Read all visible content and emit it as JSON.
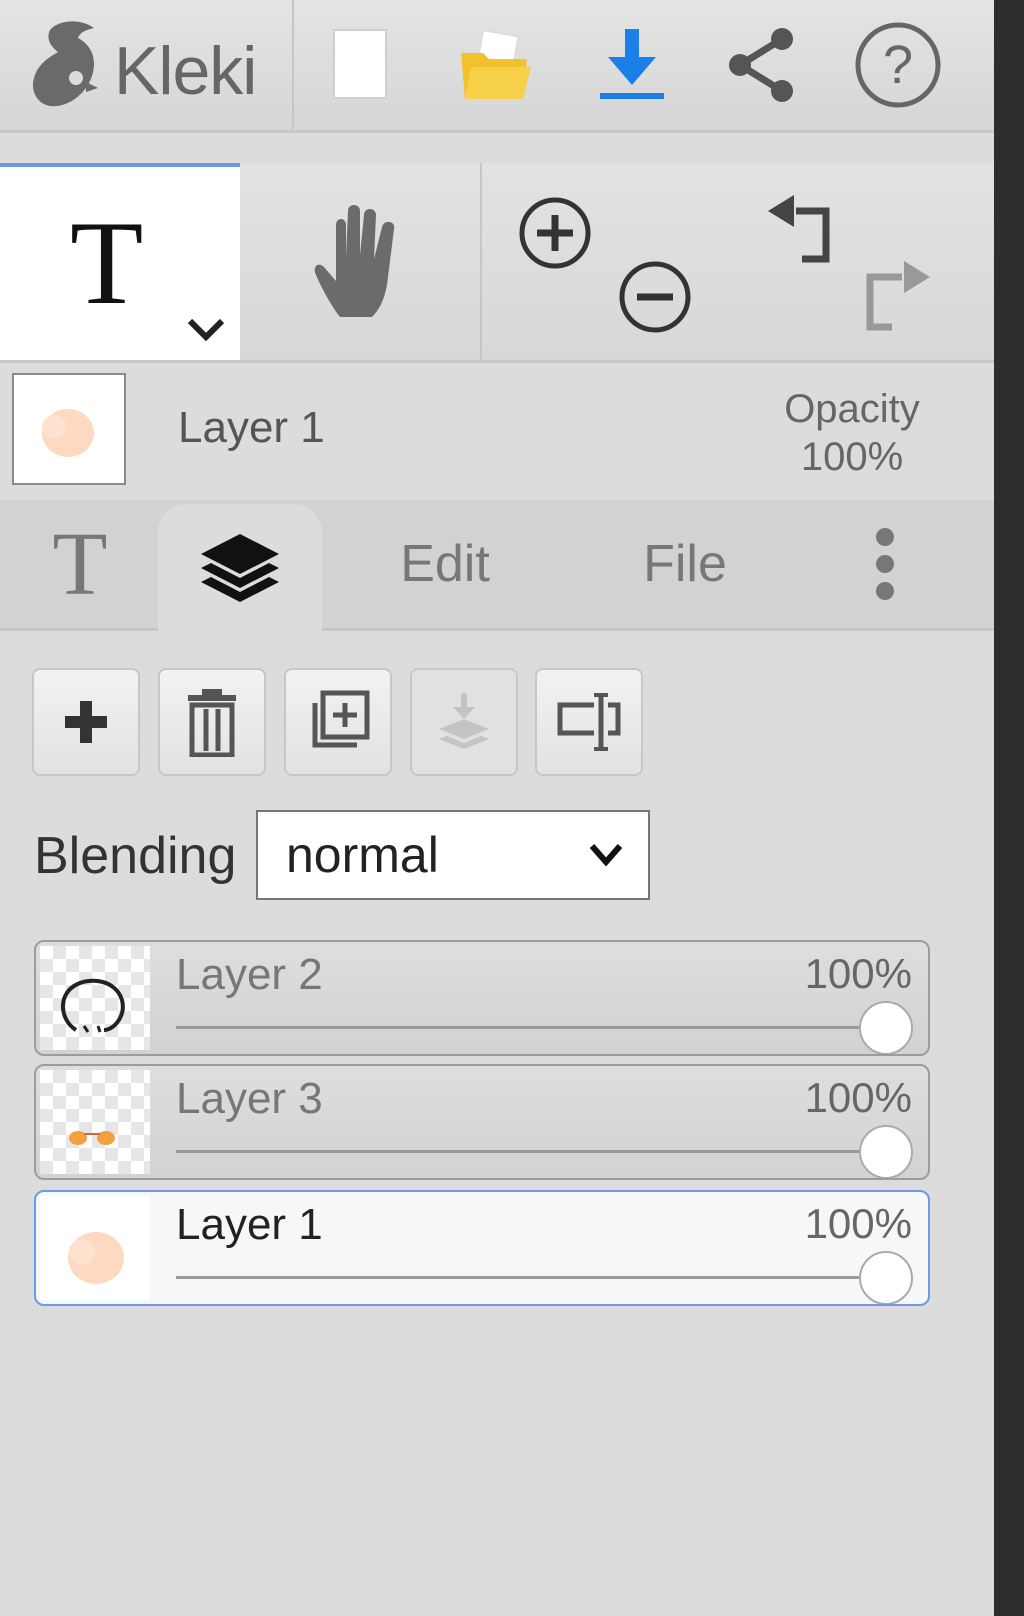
{
  "app": {
    "name": "Kleki"
  },
  "toolbar": {
    "icons": [
      "new-image-icon",
      "open-folder-icon",
      "download-icon",
      "share-icon",
      "help-icon"
    ]
  },
  "tools": {
    "active_tool_icon": "text-tool-icon",
    "items": [
      "text-tool-icon",
      "hand-icon",
      "zoom-in-icon",
      "zoom-out-icon",
      "undo-icon",
      "redo-icon"
    ]
  },
  "active_layer": {
    "name": "Layer 1",
    "opacity_label": "Opacity",
    "opacity_value": "100%"
  },
  "tabs": {
    "items": [
      {
        "id": "text",
        "icon": "text-tab-icon"
      },
      {
        "id": "layers",
        "icon": "layers-icon",
        "active": true
      },
      {
        "id": "edit",
        "label": "Edit"
      },
      {
        "id": "file",
        "label": "File"
      },
      {
        "id": "more",
        "icon": "more-vertical-icon"
      }
    ]
  },
  "layer_panel": {
    "buttons": [
      "add-layer-icon",
      "delete-layer-icon",
      "duplicate-layer-icon",
      "merge-down-icon",
      "rename-layer-icon"
    ],
    "blending_label": "Blending",
    "blending_value": "normal",
    "layers": [
      {
        "name": "Layer 2",
        "opacity": "100%",
        "opacity_value": 1.0,
        "selected": false
      },
      {
        "name": "Layer 3",
        "opacity": "100%",
        "opacity_value": 1.0,
        "selected": false
      },
      {
        "name": "Layer 1",
        "opacity": "100%",
        "opacity_value": 1.0,
        "selected": true
      }
    ]
  },
  "colors": {
    "accent": "#6a9be8",
    "download_blue": "#1a7fe8",
    "folder_yellow": "#f2c12e"
  }
}
